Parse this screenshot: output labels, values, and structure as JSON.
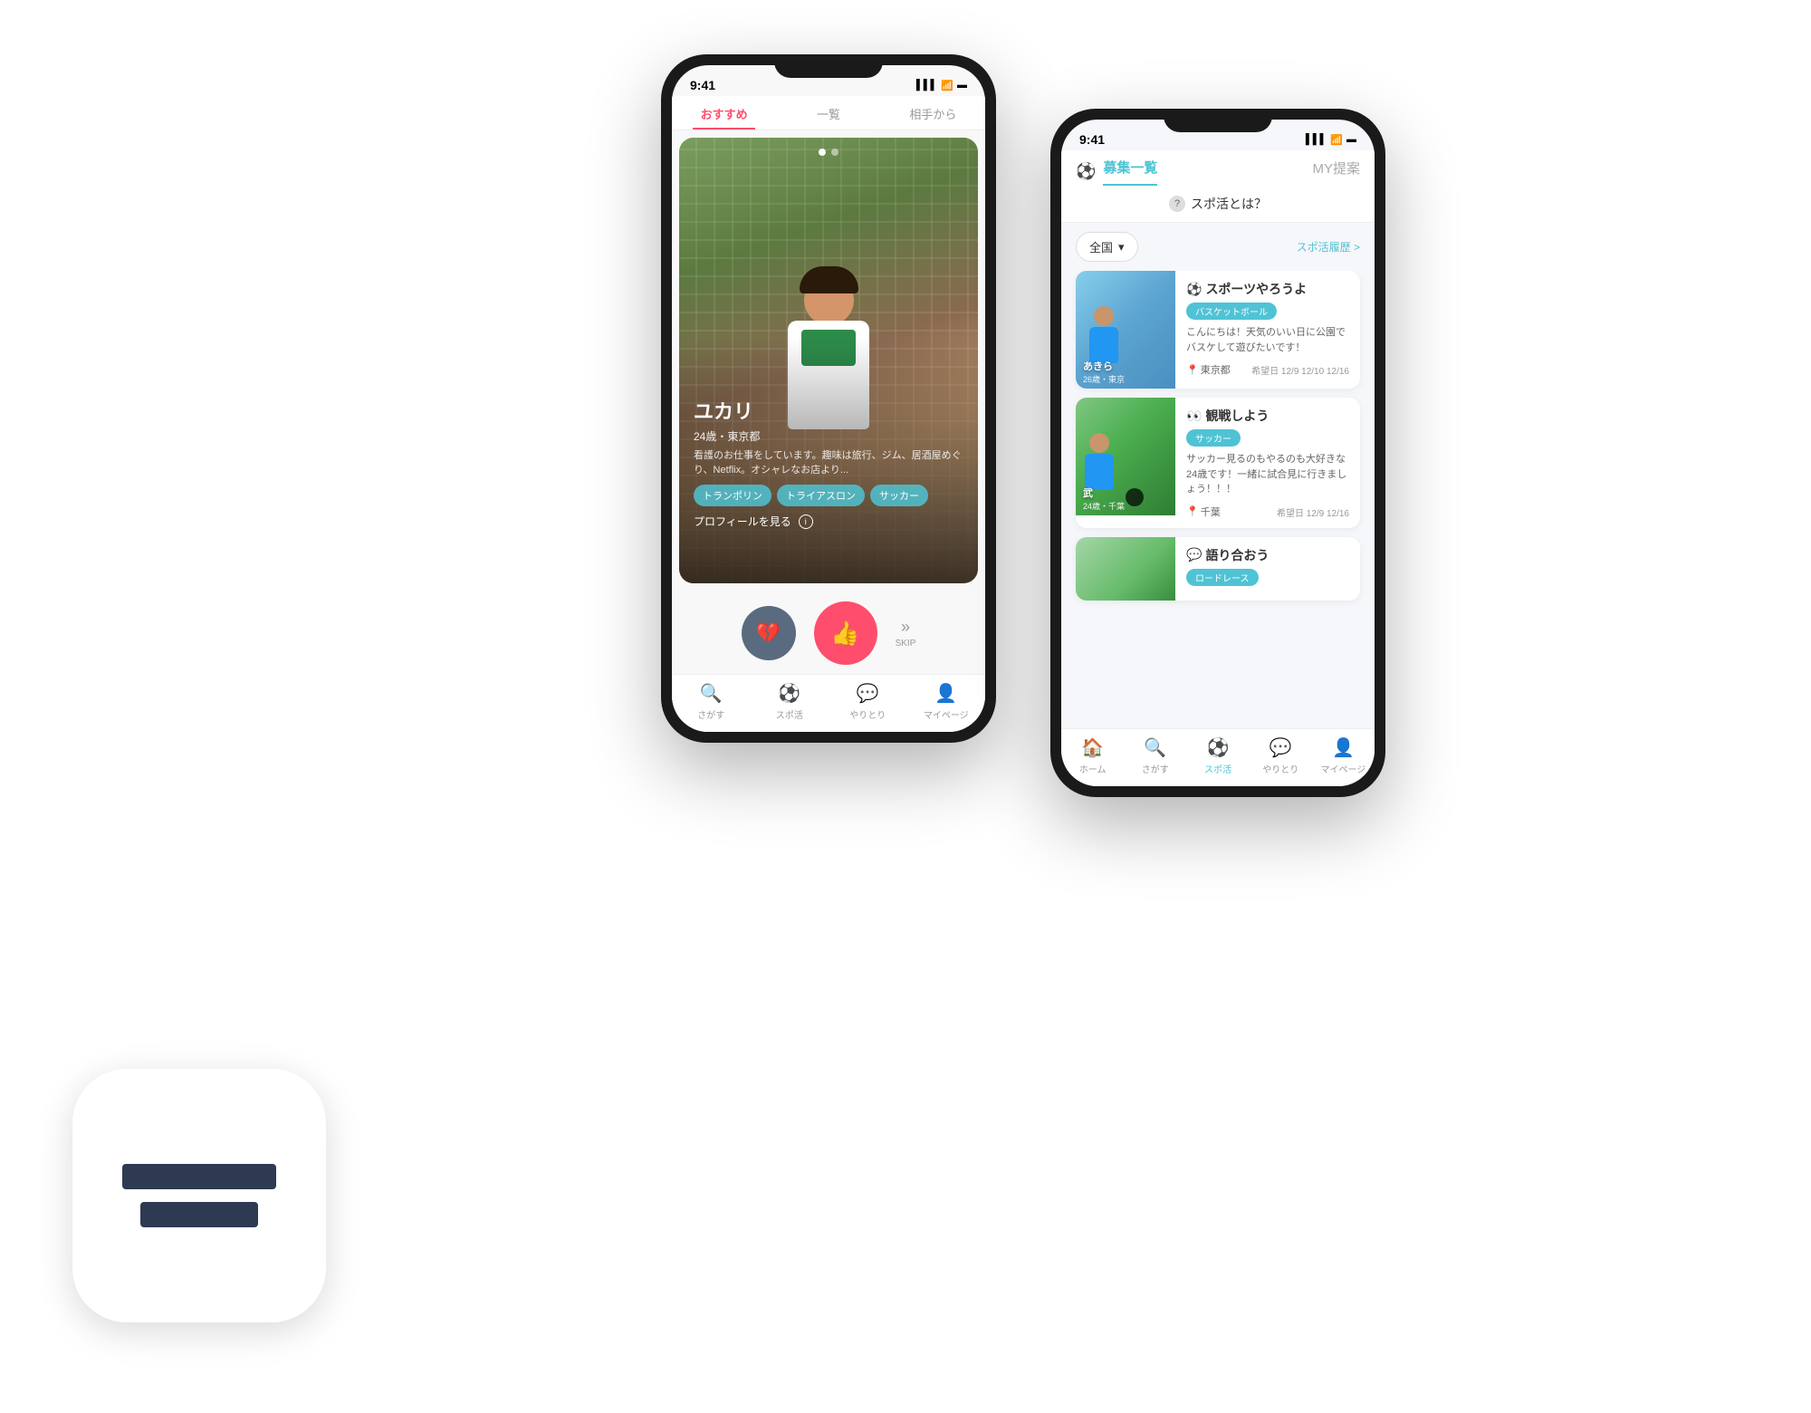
{
  "app_icon": {
    "stripes": [
      "stripe1",
      "stripe2"
    ]
  },
  "left_phone": {
    "status_bar": {
      "time": "9:41",
      "signal": "▌▌▌",
      "wifi": "WiFi",
      "battery": "▬"
    },
    "tabs": [
      {
        "label": "おすすめ",
        "active": true
      },
      {
        "label": "一覧",
        "active": false
      },
      {
        "label": "相手から",
        "active": false
      }
    ],
    "profile": {
      "name": "ユカリ",
      "age": "24歳・東京都",
      "description": "看護のお仕事をしています。趣味は旅行、ジム、居酒屋めぐり、Netflix。オシャレなお店より...",
      "tags": [
        "トランポリン",
        "トライアスロン",
        "サッカー"
      ],
      "view_label": "プロフィールを見る"
    },
    "action_buttons": {
      "skip_label": "SKIP"
    },
    "nav_items": [
      {
        "label": "さがす",
        "active": false
      },
      {
        "label": "スポ活",
        "active": false
      },
      {
        "label": "やりとり",
        "active": false
      },
      {
        "label": "マイページ",
        "active": false
      }
    ]
  },
  "right_phone": {
    "status_bar": {
      "time": "9:41",
      "signal": "▌▌▌",
      "wifi": "WiFi",
      "battery": "▬"
    },
    "header": {
      "tab_active": "募集一覧",
      "tab_inactive": "MY提案"
    },
    "spokatsu_banner": "スポ活とは？",
    "filter": {
      "area": "全国",
      "history": "スポ活履歴 >"
    },
    "cards": [
      {
        "title": "スポーツやろうよ",
        "sport_tag": "バスケットボール",
        "description": "こんにちは！天気のいい日に公園でバスケして遊びたいです！",
        "person_name": "あきら",
        "person_age": "26歳・東京",
        "location": "東京都",
        "dates": "希望日 12/9 12/10 12/16",
        "photo_type": "basketball"
      },
      {
        "title": "観戦しよう",
        "sport_tag": "サッカー",
        "description": "サッカー見るのもやるのも大好きな24歳です！一緒に試合見に行きましょう！！！",
        "person_name": "武",
        "person_age": "24歳・千葉",
        "location": "千葉",
        "dates": "希望日 12/9 12/16",
        "photo_type": "soccer"
      },
      {
        "title": "語り合おう",
        "sport_tag": "ロードレース",
        "description": "",
        "person_name": "",
        "person_age": "",
        "location": "",
        "dates": "",
        "photo_type": "road"
      }
    ],
    "nav_items": [
      {
        "label": "ホーム",
        "active": false
      },
      {
        "label": "さがす",
        "active": false
      },
      {
        "label": "スポ活",
        "active": true
      },
      {
        "label": "やりとり",
        "active": false
      },
      {
        "label": "マイページ",
        "active": false
      }
    ]
  }
}
